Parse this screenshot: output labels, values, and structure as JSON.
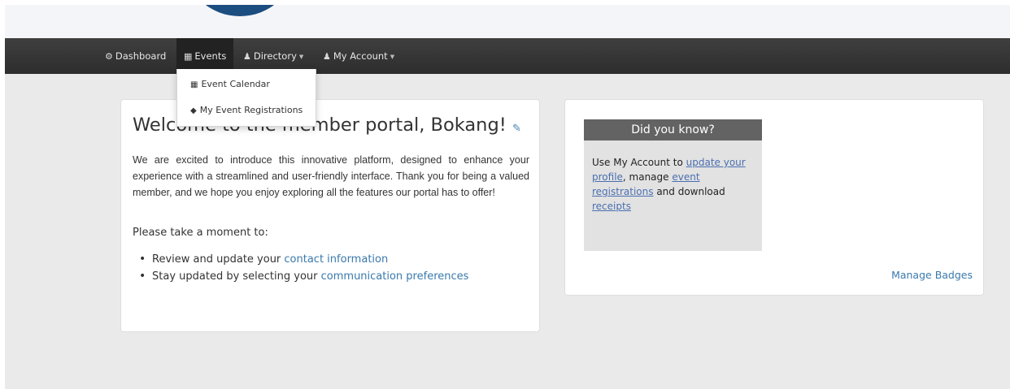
{
  "nav": {
    "dashboard": {
      "icon": "dashboard-icon",
      "label": "Dashboard"
    },
    "events": {
      "icon": "calendar-icon",
      "label": "Events"
    },
    "directory": {
      "icon": "group-icon",
      "label": "Directory"
    },
    "account": {
      "icon": "user-icon",
      "label": "My Account"
    }
  },
  "events_menu": [
    {
      "icon": "calendar-icon",
      "label": "Event Calendar"
    },
    {
      "icon": "tag-icon",
      "label": "My Event Registrations"
    }
  ],
  "welcome": {
    "title": "Welcome to the member portal, Bokang!",
    "intro": "We are excited to introduce this innovative platform, designed to enhance your experience with a streamlined and user-friendly interface. Thank you for being a valued member, and we hope you enjoy exploring all the features our portal has to offer!",
    "prompt": "Please take a moment to:",
    "items": [
      {
        "text": "Review and update your ",
        "link": "contact information"
      },
      {
        "text": "Stay updated by selecting your ",
        "link": "communication preferences"
      }
    ]
  },
  "did_you_know": {
    "title": "Did you know?",
    "t1": "Use My Account to ",
    "link1": "update your profile",
    "t2": ", manage ",
    "link2": "event registrations",
    "t3": " and download ",
    "link3": "receipts"
  },
  "manage_badges": "Manage Badges",
  "colors": {
    "navbar": "#333333",
    "accent": "#3a79ad",
    "logo": "#1c4d80",
    "dyk_header": "#636363"
  }
}
